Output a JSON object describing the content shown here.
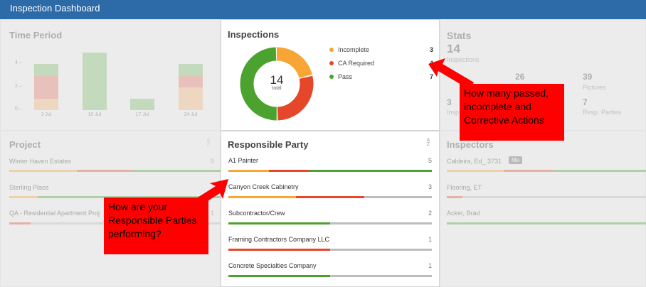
{
  "app_title": "Inspection Dashboard",
  "colors": {
    "incomplete": "#f7a534",
    "ca_required": "#e4472a",
    "pass": "#4ca22f",
    "neutral": "#bdbdbd",
    "header": "#2c6ba8",
    "callout": "#ff0000"
  },
  "time_period": {
    "title": "Time Period",
    "y_ticks": [
      "4 –",
      "2 –",
      "0 –"
    ],
    "x_ticks": [
      "3 Jul",
      "10 Jul",
      "17 Jul",
      "24 Jul"
    ]
  },
  "inspections": {
    "title": "Inspections",
    "total": "14",
    "total_label": "total",
    "legend": [
      {
        "label": "Incomplete",
        "count": "3",
        "value": 3,
        "color": "#f7a534"
      },
      {
        "label": "CA Required",
        "count": "4",
        "value": 4,
        "color": "#e4472a"
      },
      {
        "label": "Pass",
        "count": "7",
        "value": 7,
        "color": "#4ca22f"
      }
    ]
  },
  "stats": {
    "title": "Stats",
    "inspections_value": "14",
    "inspections_label": "Inspections",
    "items": [
      {
        "value": "26",
        "label": ""
      },
      {
        "value": "39",
        "label": "Pictures"
      },
      {
        "value": "3",
        "label": "Insp"
      },
      {
        "value": "7",
        "label": "Resp. Parties"
      }
    ]
  },
  "project": {
    "title": "Project",
    "rows": [
      {
        "name": "Winter Haven Estates",
        "count": "9"
      },
      {
        "name": "Sterling Place",
        "count": ""
      },
      {
        "name": "QA - Residential Apartment Proj",
        "count": "1"
      }
    ]
  },
  "responsible_party": {
    "title": "Responsible Party",
    "sort_icon_text": "A Z",
    "rows": [
      {
        "name": "A1 Painter",
        "count": "5",
        "incomplete": 1,
        "ca": 1,
        "pass": 3,
        "neutral": 0
      },
      {
        "name": "Canyon Creek Cabinetry",
        "count": "3",
        "incomplete": 1,
        "ca": 1,
        "pass": 0,
        "neutral": 1
      },
      {
        "name": "Subcontractor/Crew",
        "count": "2",
        "incomplete": 0,
        "ca": 0,
        "pass": 1,
        "neutral": 1
      },
      {
        "name": "Framing Contractors Company LLC",
        "count": "1",
        "incomplete": 0,
        "ca": 1,
        "pass": 0,
        "neutral": 1
      },
      {
        "name": "Concrete Specialties Company",
        "count": "1",
        "incomplete": 0,
        "ca": 0,
        "pass": 1,
        "neutral": 1
      }
    ]
  },
  "inspectors": {
    "title": "Inspectors",
    "rows": [
      {
        "name": "Caldeira, Ed_ 3731",
        "badge": "Me"
      },
      {
        "name": "Flooring, ET",
        "badge": ""
      },
      {
        "name": "Acker, Brad",
        "badge": ""
      }
    ]
  },
  "callouts": {
    "top_right": "How many passed, incomplete and Corrective Actions",
    "left": "How are your Responsible Parties performing?"
  }
}
